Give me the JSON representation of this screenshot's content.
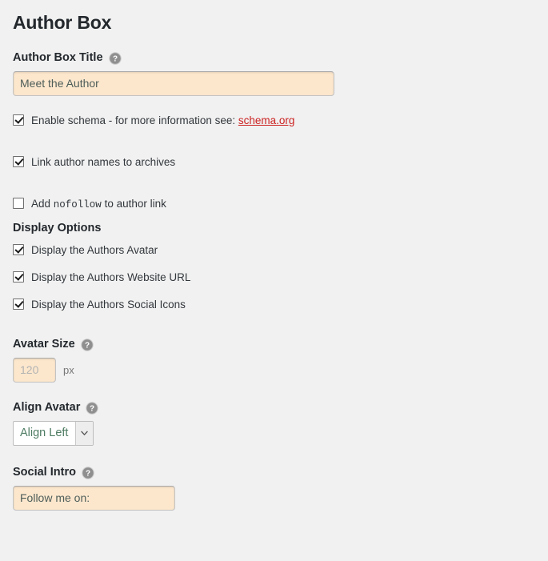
{
  "page": {
    "title": "Author Box",
    "background_color": "#f1f1f1",
    "link_color": "#cc2222",
    "input_background": "#fce7cd"
  },
  "author_box_title": {
    "label": "Author Box Title",
    "help_icon": "help-circle-icon",
    "value": "Meet the Author",
    "placeholder": "Meet the Author"
  },
  "options": [
    {
      "label_before": "Enable schema - for more information see:",
      "link_text": "schema.org",
      "checked": true
    },
    {
      "label": "Link author names to archives",
      "checked": true
    },
    {
      "label_before": "Add",
      "code": "nofollow",
      "label_after": "to author link",
      "checked": false
    }
  ],
  "display_options": {
    "heading": "Display Options",
    "items": [
      {
        "label": "Display the Authors Avatar",
        "checked": true
      },
      {
        "label": "Display the Authors Website URL",
        "checked": true
      },
      {
        "label": "Display the Authors Social Icons",
        "checked": true
      }
    ]
  },
  "avatar_size": {
    "label": "Avatar Size",
    "help_icon": "help-circle-icon",
    "value": "120",
    "placeholder": "120",
    "unit": "px"
  },
  "align_avatar": {
    "label": "Align Avatar",
    "help_icon": "help-circle-icon",
    "selected": "Align Left",
    "options": [
      "Align Left"
    ]
  },
  "social_intro": {
    "label": "Social Intro",
    "help_icon": "help-circle-icon",
    "value": "Follow me on:",
    "placeholder": "Follow me on:"
  }
}
